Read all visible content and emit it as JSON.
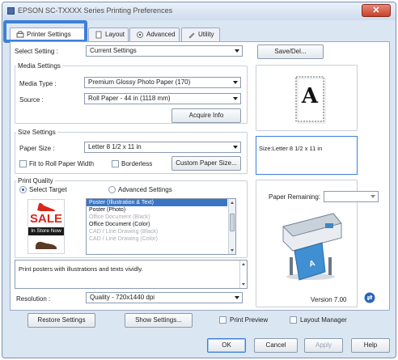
{
  "window": {
    "title": "EPSON SC-TXXXX Series Printing Preferences",
    "close_glyph": "✕"
  },
  "tabs": [
    {
      "label": "Printer Settings",
      "icon": "printer-icon",
      "active": true
    },
    {
      "label": "Layout",
      "icon": "layout-icon",
      "active": false
    },
    {
      "label": "Advanced",
      "icon": "advanced-icon",
      "active": false
    },
    {
      "label": "Utility",
      "icon": "utility-icon",
      "active": false
    }
  ],
  "select_setting": {
    "label": "Select Setting :",
    "value": "Current Settings",
    "save_del_label": "Save/Del..."
  },
  "media_settings": {
    "title": "Media Settings",
    "media_type_label": "Media Type :",
    "media_type_value": "Premium Glossy Photo Paper (170)",
    "source_label": "Source :",
    "source_value": "Roll Paper - 44 in (1118 mm)",
    "acquire_info_label": "Acquire Info"
  },
  "preview": {
    "letter": "A",
    "size_text": "Size:Letter 8 1/2 x 11 in"
  },
  "size_settings": {
    "title": "Size Settings",
    "paper_size_label": "Paper Size :",
    "paper_size_value": "Letter 8 1/2 x 11 in",
    "fit_to_roll_label": "Fit to Roll Paper Width",
    "borderless_label": "Borderless",
    "custom_paper_size_label": "Custom Paper Size..."
  },
  "print_quality": {
    "title": "Print Quality",
    "select_target_label": "Select Target",
    "advanced_settings_label": "Advanced Settings",
    "selected_mode": "select_target",
    "sale_text": "SALE",
    "in_store_now_text": "In Store Now",
    "targets": [
      {
        "label": "Poster (Illustration & Text)",
        "state": "selected"
      },
      {
        "label": "Poster (Photo)",
        "state": "normal"
      },
      {
        "label": "Office Document (Black)",
        "state": "disabled"
      },
      {
        "label": "Office Document (Color)",
        "state": "normal"
      },
      {
        "label": "CAD / Line Drawing (Black)",
        "state": "disabled"
      },
      {
        "label": "CAD / Line Drawing (Color)",
        "state": "disabled"
      }
    ],
    "description": "Print posters with illustrations and texts vividly.",
    "resolution_label": "Resolution :",
    "resolution_value": "Quality - 720x1440 dpi"
  },
  "paper_remaining": {
    "label": "Paper Remaining:",
    "value": ""
  },
  "version": "Version 7.00",
  "bottom_row": {
    "restore_settings_label": "Restore Settings",
    "show_settings_label": "Show Settings...",
    "print_preview_label": "Print Preview",
    "layout_manager_label": "Layout Manager"
  },
  "dialog_buttons": {
    "ok": "OK",
    "cancel": "Cancel",
    "apply": "Apply",
    "help": "Help"
  },
  "colors": {
    "accent": "#3d7fd9",
    "selection": "#3a75c4",
    "sale_red": "#d9261c"
  }
}
